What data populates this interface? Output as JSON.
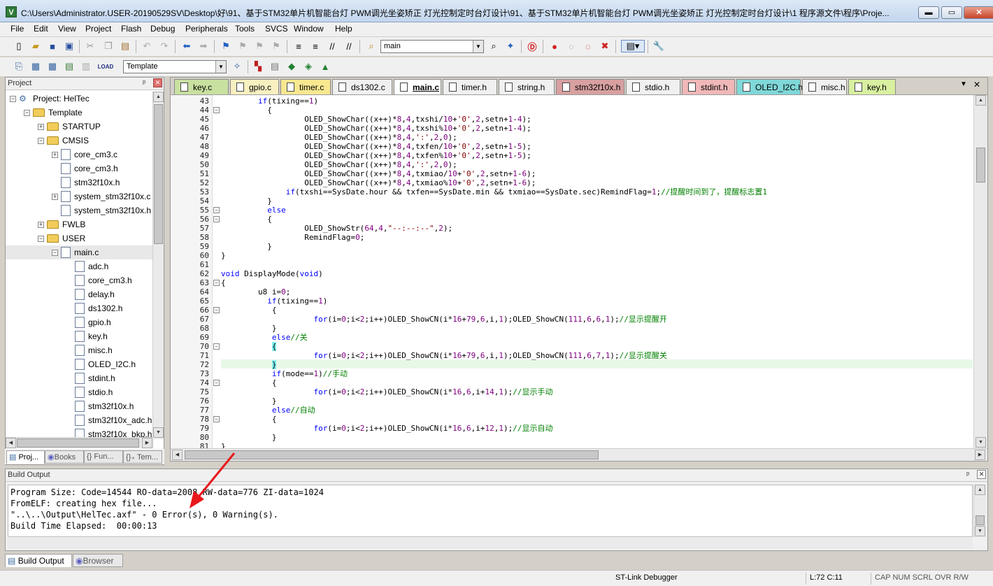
{
  "window": {
    "title": "C:\\Users\\Administrator.USER-20190529SV\\Desktop\\好\\91、基于STM32单片机智能台灯 PWM调光坐姿矫正 灯光控制定时台灯设计\\91、基于STM32单片机智能台灯 PWM调光坐姿矫正 灯光控制定时台灯设计\\1 程序源文件\\程序\\Proje...",
    "icon_letter": "V",
    "minimize": "▬",
    "maximize": "▭",
    "close": "✕"
  },
  "menu": [
    "File",
    "Edit",
    "View",
    "Project",
    "Flash",
    "Debug",
    "Peripherals",
    "Tools",
    "SVCS",
    "Window",
    "Help"
  ],
  "toolbar": {
    "find_value": "main",
    "target_value": "Template",
    "combo_arrow": "▼"
  },
  "project_panel": {
    "title": "Project",
    "pin": "ᵖ",
    "close": "✕",
    "tree": [
      {
        "label": "Project: HelTec",
        "kind": "project",
        "exp": "−",
        "indent": 0
      },
      {
        "label": "Template",
        "kind": "folder",
        "exp": "−",
        "indent": 1
      },
      {
        "label": "STARTUP",
        "kind": "folder",
        "exp": "+",
        "indent": 2
      },
      {
        "label": "CMSIS",
        "kind": "folder",
        "exp": "−",
        "indent": 2
      },
      {
        "label": "core_cm3.c",
        "kind": "file",
        "exp": "+",
        "indent": 3
      },
      {
        "label": "core_cm3.h",
        "kind": "file",
        "exp": "",
        "indent": 3
      },
      {
        "label": "stm32f10x.h",
        "kind": "file",
        "exp": "",
        "indent": 3
      },
      {
        "label": "system_stm32f10x.c",
        "kind": "file",
        "exp": "+",
        "indent": 3
      },
      {
        "label": "system_stm32f10x.h",
        "kind": "file",
        "exp": "",
        "indent": 3
      },
      {
        "label": "FWLB",
        "kind": "folder",
        "exp": "+",
        "indent": 2
      },
      {
        "label": "USER",
        "kind": "folder",
        "exp": "−",
        "indent": 2
      },
      {
        "label": "main.c",
        "kind": "file",
        "exp": "−",
        "indent": 3,
        "selected": true
      },
      {
        "label": "adc.h",
        "kind": "file",
        "exp": "",
        "indent": 4
      },
      {
        "label": "core_cm3.h",
        "kind": "file",
        "exp": "",
        "indent": 4
      },
      {
        "label": "delay.h",
        "kind": "file",
        "exp": "",
        "indent": 4
      },
      {
        "label": "ds1302.h",
        "kind": "file",
        "exp": "",
        "indent": 4
      },
      {
        "label": "gpio.h",
        "kind": "file",
        "exp": "",
        "indent": 4
      },
      {
        "label": "key.h",
        "kind": "file",
        "exp": "",
        "indent": 4
      },
      {
        "label": "misc.h",
        "kind": "file",
        "exp": "",
        "indent": 4
      },
      {
        "label": "OLED_I2C.h",
        "kind": "file",
        "exp": "",
        "indent": 4
      },
      {
        "label": "stdint.h",
        "kind": "file",
        "exp": "",
        "indent": 4
      },
      {
        "label": "stdio.h",
        "kind": "file",
        "exp": "",
        "indent": 4
      },
      {
        "label": "stm32f10x.h",
        "kind": "file",
        "exp": "",
        "indent": 4
      },
      {
        "label": "stm32f10x_adc.h",
        "kind": "file",
        "exp": "",
        "indent": 4
      },
      {
        "label": "stm32f10x_bkp.h",
        "kind": "file",
        "exp": "",
        "indent": 4
      }
    ],
    "tabs": [
      "Proj...",
      "Books",
      "{} Fun...",
      "{}₊ Tem..."
    ]
  },
  "editor": {
    "tabs": [
      {
        "label": "key.c",
        "color": "#c8e0a0"
      },
      {
        "label": "gpio.c",
        "color": "#f8f0c0"
      },
      {
        "label": "timer.c",
        "color": "#f8e890"
      },
      {
        "label": "ds1302.c",
        "color": "#f0f0f0"
      },
      {
        "label": "main.c",
        "color": "#f0f0f0",
        "active": true
      },
      {
        "label": "timer.h",
        "color": "#f0f0f0"
      },
      {
        "label": "string.h",
        "color": "#f0f0f0"
      },
      {
        "label": "stm32f10x.h",
        "color": "#d8a0a0"
      },
      {
        "label": "stdio.h",
        "color": "#f0f0f0"
      },
      {
        "label": "stdint.h",
        "color": "#f0b8b8"
      },
      {
        "label": "OLED_I2C.h",
        "color": "#80d8d8"
      },
      {
        "label": "misc.h",
        "color": "#f0f0f0"
      },
      {
        "label": "key.h",
        "color": "#d8f0a0"
      }
    ],
    "tab_menu": "▼",
    "tab_close": "✕",
    "lines": [
      {
        "n": "43",
        "html": "        <span class='kw'>if</span>(tixing==<span class='num'>1</span>)"
      },
      {
        "n": "44",
        "html": "          {"
      },
      {
        "n": "45",
        "html": "                  OLED_ShowChar((x++)*<span class='num'>8</span>,<span class='num'>4</span>,txshi/<span class='num'>10</span>+<span class='str'>'0'</span>,<span class='num'>2</span>,setn+<span class='num'>1</span>-<span class='num'>4</span>);"
      },
      {
        "n": "46",
        "html": "                  OLED_ShowChar((x++)*<span class='num'>8</span>,<span class='num'>4</span>,txshi%<span class='num'>10</span>+<span class='str'>'0'</span>,<span class='num'>2</span>,setn+<span class='num'>1</span>-<span class='num'>4</span>);"
      },
      {
        "n": "47",
        "html": "                  OLED_ShowChar((x++)*<span class='num'>8</span>,<span class='num'>4</span>,<span class='str'>':'</span>,<span class='num'>2</span>,<span class='num'>0</span>);"
      },
      {
        "n": "48",
        "html": "                  OLED_ShowChar((x++)*<span class='num'>8</span>,<span class='num'>4</span>,txfen/<span class='num'>10</span>+<span class='str'>'0'</span>,<span class='num'>2</span>,setn+<span class='num'>1</span>-<span class='num'>5</span>);"
      },
      {
        "n": "49",
        "html": "                  OLED_ShowChar((x++)*<span class='num'>8</span>,<span class='num'>4</span>,txfen%<span class='num'>10</span>+<span class='str'>'0'</span>,<span class='num'>2</span>,setn+<span class='num'>1</span>-<span class='num'>5</span>);"
      },
      {
        "n": "50",
        "html": "                  OLED_ShowChar((x++)*<span class='num'>8</span>,<span class='num'>4</span>,<span class='str'>':'</span>,<span class='num'>2</span>,<span class='num'>0</span>);"
      },
      {
        "n": "51",
        "html": "                  OLED_ShowChar((x++)*<span class='num'>8</span>,<span class='num'>4</span>,txmiao/<span class='num'>10</span>+<span class='str'>'0'</span>,<span class='num'>2</span>,setn+<span class='num'>1</span>-<span class='num'>6</span>);"
      },
      {
        "n": "52",
        "html": "                  OLED_ShowChar((x++)*<span class='num'>8</span>,<span class='num'>4</span>,txmiao%<span class='num'>10</span>+<span class='str'>'0'</span>,<span class='num'>2</span>,setn+<span class='num'>1</span>-<span class='num'>6</span>);"
      },
      {
        "n": "53",
        "html": "              <span class='kw'>if</span>(txshi==SysDate.hour &amp;&amp; txfen==SysDate.min &amp;&amp; txmiao==SysDate.sec)RemindFlag=<span class='num'>1</span>;<span class='cm'>//提醒时间到了，提醒标志置1</span>"
      },
      {
        "n": "54",
        "html": "          }"
      },
      {
        "n": "55",
        "html": "          <span class='kw'>else</span>"
      },
      {
        "n": "56",
        "html": "          {"
      },
      {
        "n": "57",
        "html": "                  OLED_ShowStr(<span class='num'>64</span>,<span class='num'>4</span>,<span class='str'>\"--:--:--\"</span>,<span class='num'>2</span>);"
      },
      {
        "n": "58",
        "html": "                  RemindFlag=<span class='num'>0</span>;"
      },
      {
        "n": "59",
        "html": "          }"
      },
      {
        "n": "60",
        "html": "}"
      },
      {
        "n": "61",
        "html": ""
      },
      {
        "n": "62",
        "html": "<span class='kw'>void</span> DisplayMode(<span class='kw'>void</span>)"
      },
      {
        "n": "63",
        "html": "{"
      },
      {
        "n": "64",
        "html": "        u8 i=<span class='num'>0</span>;"
      },
      {
        "n": "65",
        "html": "          <span class='kw'>if</span>(tixing==<span class='num'>1</span>)"
      },
      {
        "n": "66",
        "html": "           {"
      },
      {
        "n": "67",
        "html": "                    <span class='kw'>for</span>(i=<span class='num'>0</span>;i&lt;<span class='num'>2</span>;i++)OLED_ShowCN(i*<span class='num'>16</span>+<span class='num'>79</span>,<span class='num'>6</span>,i,<span class='num'>1</span>);OLED_ShowCN(<span class='num'>111</span>,<span class='num'>6</span>,<span class='num'>6</span>,<span class='num'>1</span>);<span class='cm'>//显示提醒开</span>"
      },
      {
        "n": "68",
        "html": "           }"
      },
      {
        "n": "69",
        "html": "           <span class='kw'>else</span><span class='cm'>//关</span>"
      },
      {
        "n": "70",
        "html": "           <span style='background:#80f0f0'>{</span>"
      },
      {
        "n": "71",
        "html": "                    <span class='kw'>for</span>(i=<span class='num'>0</span>;i&lt;<span class='num'>2</span>;i++)OLED_ShowCN(i*<span class='num'>16</span>+<span class='num'>79</span>,<span class='num'>6</span>,i,<span class='num'>1</span>);OLED_ShowCN(<span class='num'>111</span>,<span class='num'>6</span>,<span class='num'>7</span>,<span class='num'>1</span>);<span class='cm'>//显示提醒关</span>"
      },
      {
        "n": "72",
        "html": "           <span style='background:#80f0f0'>}</span>"
      },
      {
        "n": "73",
        "html": "           <span class='kw'>if</span>(mode==<span class='num'>1</span>)<span class='cm'>//手动</span>"
      },
      {
        "n": "74",
        "html": "           {"
      },
      {
        "n": "75",
        "html": "                    <span class='kw'>for</span>(i=<span class='num'>0</span>;i&lt;<span class='num'>2</span>;i++)OLED_ShowCN(i*<span class='num'>16</span>,<span class='num'>6</span>,i+<span class='num'>14</span>,<span class='num'>1</span>);<span class='cm'>//显示手动</span>"
      },
      {
        "n": "76",
        "html": "           }"
      },
      {
        "n": "77",
        "html": "           <span class='kw'>else</span><span class='cm'>//自动</span>"
      },
      {
        "n": "78",
        "html": "           {"
      },
      {
        "n": "79",
        "html": "                    <span class='kw'>for</span>(i=<span class='num'>0</span>;i&lt;<span class='num'>2</span>;i++)OLED_ShowCN(i*<span class='num'>16</span>,<span class='num'>6</span>,i+<span class='num'>12</span>,<span class='num'>1</span>);<span class='cm'>//显示自动</span>"
      },
      {
        "n": "80",
        "html": "           }"
      },
      {
        "n": "81",
        "html": "}"
      }
    ],
    "fold_markers": {
      "44": "−",
      "55": "−",
      "56": "−",
      "63": "−",
      "66": "−",
      "70": "−",
      "74": "−",
      "78": "−"
    }
  },
  "build_output": {
    "title": "Build Output",
    "pin": "ᵖ",
    "close": "✕",
    "text": "Program Size: Code=14544 RO-data=2008 RW-data=776 ZI-data=1024\nFromELF: creating hex file...\n\"..\\..\\Output\\HelTec.axf\" - 0 Error(s), 0 Warning(s).\nBuild Time Elapsed:  00:00:13",
    "tabs": [
      "Build Output",
      "Browser"
    ]
  },
  "status": {
    "debugger": "ST-Link Debugger",
    "position": "L:72 C:11",
    "flags": "CAP  NUM  SCRL  OVR  R/W"
  },
  "icons": {
    "new": "new-file-icon",
    "open": "open-folder-icon",
    "save": "save-icon",
    "save_all": "save-all-icon",
    "cut": "cut-icon",
    "copy": "copy-icon",
    "paste": "paste-icon",
    "undo": "undo-icon",
    "redo": "redo-icon",
    "back": "nav-back-icon",
    "forward": "nav-forward-icon",
    "bookmark": "bookmark-icon",
    "indent": "indent-icon",
    "outdent": "outdent-icon",
    "comment": "comment-icon",
    "uncomment": "uncomment-icon",
    "find": "find-icon",
    "debug": "debug-icon",
    "breakpoint": "breakpoint-icon",
    "build": "build-icon",
    "rebuild": "rebuild-icon",
    "download": "download-icon",
    "options": "target-options-icon",
    "wrench": "wrench-icon"
  },
  "colors": {
    "accent_arrow": "#e8181c",
    "keyword": "#0000ff",
    "comment": "#008000",
    "current_line": "#e8f8e8"
  }
}
